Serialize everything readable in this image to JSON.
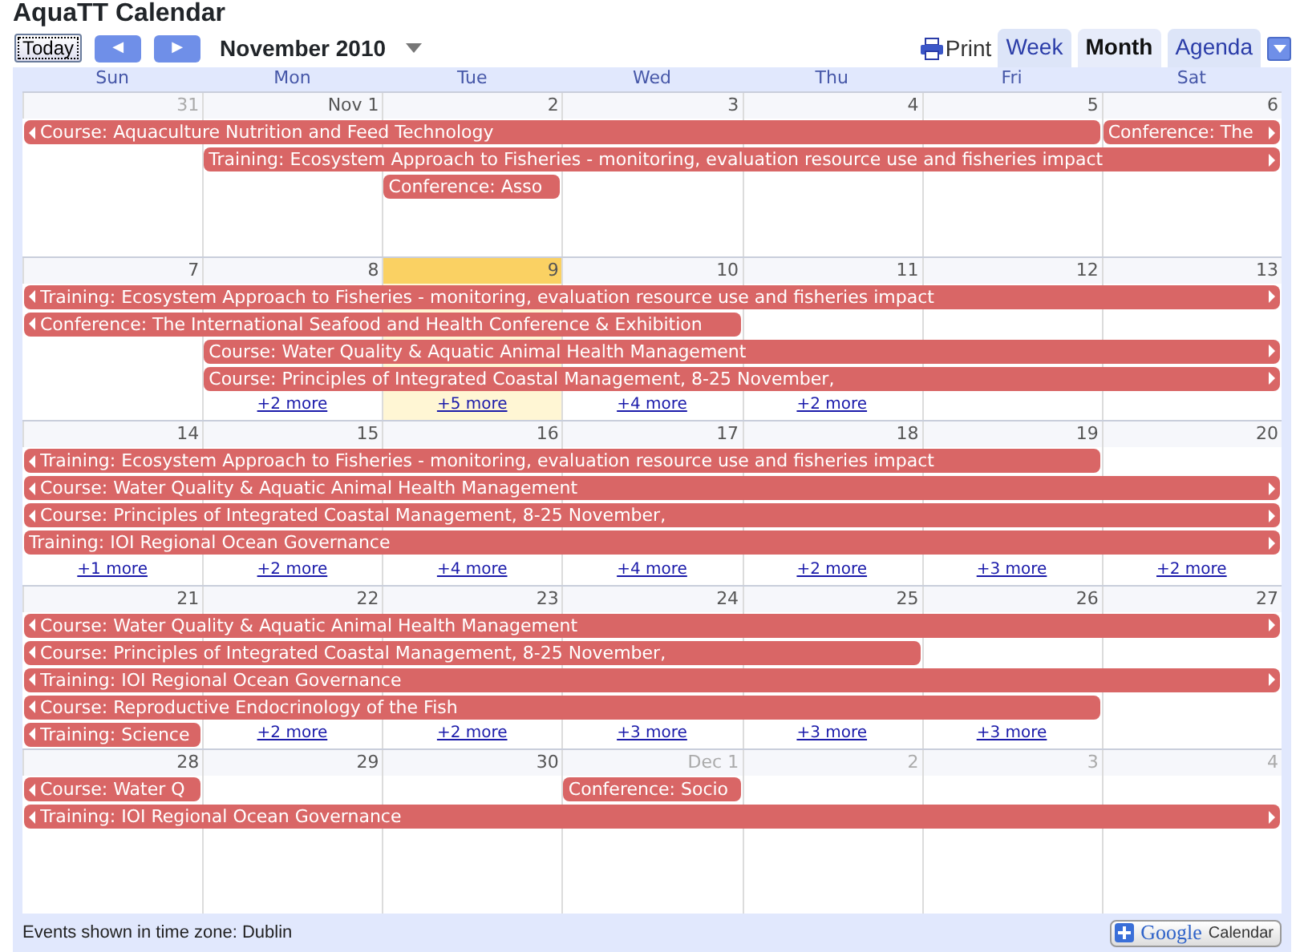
{
  "title": "AquaTT Calendar",
  "toolbar": {
    "today": "Today",
    "prev": "◀",
    "next": "▶",
    "period": "November 2010",
    "print": "Print"
  },
  "tabs": [
    {
      "label": "Week",
      "selected": false
    },
    {
      "label": "Month",
      "selected": true
    },
    {
      "label": "Agenda",
      "selected": false
    }
  ],
  "weekdays": [
    "Sun",
    "Mon",
    "Tue",
    "Wed",
    "Thu",
    "Fri",
    "Sat"
  ],
  "weeks": [
    {
      "days": [
        {
          "label": "31",
          "other_month": true,
          "today": false
        },
        {
          "label": "Nov 1",
          "other_month": false,
          "today": false
        },
        {
          "label": "2",
          "other_month": false,
          "today": false
        },
        {
          "label": "3",
          "other_month": false,
          "today": false
        },
        {
          "label": "4",
          "other_month": false,
          "today": false
        },
        {
          "label": "5",
          "other_month": false,
          "today": false
        },
        {
          "label": "6",
          "other_month": false,
          "today": false
        }
      ],
      "lanes": [
        [
          {
            "kind": "event",
            "title": "Course: Aquaculture Nutrition and Feed Technology",
            "continues_before": true,
            "continues_after": false
          },
          {
            "kind": "continued"
          },
          {
            "kind": "continued"
          },
          {
            "kind": "continued"
          },
          {
            "kind": "continued"
          },
          {
            "kind": "continued"
          },
          {
            "kind": "event",
            "title": "Conference: The",
            "continues_before": false,
            "continues_after": true
          }
        ],
        [
          {
            "kind": "empty"
          },
          {
            "kind": "event",
            "title": "Training: Ecosystem Approach to Fisheries - monitoring, evaluation resource use and fisheries impact",
            "continues_before": false,
            "continues_after": true
          },
          {
            "kind": "continued"
          },
          {
            "kind": "continued"
          },
          {
            "kind": "continued"
          },
          {
            "kind": "continued"
          },
          {
            "kind": "continued"
          }
        ],
        [
          {
            "kind": "empty"
          },
          {
            "kind": "empty"
          },
          {
            "kind": "event",
            "title": "Conference: Asso",
            "continues_before": false,
            "continues_after": false
          },
          {
            "kind": "empty"
          },
          {
            "kind": "empty"
          },
          {
            "kind": "empty"
          },
          {
            "kind": "empty"
          }
        ]
      ]
    },
    {
      "days": [
        {
          "label": "7",
          "other_month": false,
          "today": false
        },
        {
          "label": "8",
          "other_month": false,
          "today": false
        },
        {
          "label": "9",
          "other_month": false,
          "today": true
        },
        {
          "label": "10",
          "other_month": false,
          "today": false
        },
        {
          "label": "11",
          "other_month": false,
          "today": false
        },
        {
          "label": "12",
          "other_month": false,
          "today": false
        },
        {
          "label": "13",
          "other_month": false,
          "today": false
        }
      ],
      "lanes": [
        [
          {
            "kind": "event",
            "title": "Training: Ecosystem Approach to Fisheries - monitoring, evaluation resource use and fisheries impact",
            "continues_before": true,
            "continues_after": true
          },
          {
            "kind": "continued"
          },
          {
            "kind": "continued"
          },
          {
            "kind": "continued"
          },
          {
            "kind": "continued"
          },
          {
            "kind": "continued"
          },
          {
            "kind": "continued"
          }
        ],
        [
          {
            "kind": "event",
            "title": "Conference: The International Seafood and Health Conference & Exhibition",
            "continues_before": true,
            "continues_after": false
          },
          {
            "kind": "continued"
          },
          {
            "kind": "continued"
          },
          {
            "kind": "continued"
          },
          {
            "kind": "empty"
          },
          {
            "kind": "empty"
          },
          {
            "kind": "empty"
          }
        ],
        [
          {
            "kind": "empty"
          },
          {
            "kind": "event",
            "title": "Course: Water Quality & Aquatic Animal Health Management",
            "continues_before": false,
            "continues_after": true
          },
          {
            "kind": "continued"
          },
          {
            "kind": "continued"
          },
          {
            "kind": "continued"
          },
          {
            "kind": "continued"
          },
          {
            "kind": "continued"
          }
        ],
        [
          {
            "kind": "empty"
          },
          {
            "kind": "event",
            "title": "Course: Principles of Integrated Coastal Management, 8-25 November,",
            "continues_before": false,
            "continues_after": true
          },
          {
            "kind": "continued"
          },
          {
            "kind": "continued"
          },
          {
            "kind": "continued"
          },
          {
            "kind": "continued"
          },
          {
            "kind": "continued"
          }
        ],
        [
          {
            "kind": "empty"
          },
          {
            "kind": "more",
            "label": "+2 more"
          },
          {
            "kind": "more",
            "label": "+5 more"
          },
          {
            "kind": "more",
            "label": "+4 more"
          },
          {
            "kind": "more",
            "label": "+2 more"
          },
          {
            "kind": "empty"
          },
          {
            "kind": "empty"
          }
        ]
      ]
    },
    {
      "days": [
        {
          "label": "14",
          "other_month": false,
          "today": false
        },
        {
          "label": "15",
          "other_month": false,
          "today": false
        },
        {
          "label": "16",
          "other_month": false,
          "today": false
        },
        {
          "label": "17",
          "other_month": false,
          "today": false
        },
        {
          "label": "18",
          "other_month": false,
          "today": false
        },
        {
          "label": "19",
          "other_month": false,
          "today": false
        },
        {
          "label": "20",
          "other_month": false,
          "today": false
        }
      ],
      "lanes": [
        [
          {
            "kind": "event",
            "title": "Training: Ecosystem Approach to Fisheries - monitoring, evaluation resource use and fisheries impact",
            "continues_before": true,
            "continues_after": false
          },
          {
            "kind": "continued"
          },
          {
            "kind": "continued"
          },
          {
            "kind": "continued"
          },
          {
            "kind": "continued"
          },
          {
            "kind": "continued"
          },
          {
            "kind": "empty"
          }
        ],
        [
          {
            "kind": "event",
            "title": "Course: Water Quality & Aquatic Animal Health Management",
            "continues_before": true,
            "continues_after": true
          },
          {
            "kind": "continued"
          },
          {
            "kind": "continued"
          },
          {
            "kind": "continued"
          },
          {
            "kind": "continued"
          },
          {
            "kind": "continued"
          },
          {
            "kind": "continued"
          }
        ],
        [
          {
            "kind": "event",
            "title": "Course: Principles of Integrated Coastal Management, 8-25 November,",
            "continues_before": true,
            "continues_after": true
          },
          {
            "kind": "continued"
          },
          {
            "kind": "continued"
          },
          {
            "kind": "continued"
          },
          {
            "kind": "continued"
          },
          {
            "kind": "continued"
          },
          {
            "kind": "continued"
          }
        ],
        [
          {
            "kind": "event",
            "title": "Training: IOI Regional Ocean Governance",
            "continues_before": false,
            "continues_after": true
          },
          {
            "kind": "continued"
          },
          {
            "kind": "continued"
          },
          {
            "kind": "continued"
          },
          {
            "kind": "continued"
          },
          {
            "kind": "continued"
          },
          {
            "kind": "continued"
          }
        ],
        [
          {
            "kind": "more",
            "label": "+1 more"
          },
          {
            "kind": "more",
            "label": "+2 more"
          },
          {
            "kind": "more",
            "label": "+4 more"
          },
          {
            "kind": "more",
            "label": "+4 more"
          },
          {
            "kind": "more",
            "label": "+2 more"
          },
          {
            "kind": "more",
            "label": "+3 more"
          },
          {
            "kind": "more",
            "label": "+2 more"
          }
        ]
      ]
    },
    {
      "days": [
        {
          "label": "21",
          "other_month": false,
          "today": false
        },
        {
          "label": "22",
          "other_month": false,
          "today": false
        },
        {
          "label": "23",
          "other_month": false,
          "today": false
        },
        {
          "label": "24",
          "other_month": false,
          "today": false
        },
        {
          "label": "25",
          "other_month": false,
          "today": false
        },
        {
          "label": "26",
          "other_month": false,
          "today": false
        },
        {
          "label": "27",
          "other_month": false,
          "today": false
        }
      ],
      "lanes": [
        [
          {
            "kind": "event",
            "title": "Course: Water Quality & Aquatic Animal Health Management",
            "continues_before": true,
            "continues_after": true
          },
          {
            "kind": "continued"
          },
          {
            "kind": "continued"
          },
          {
            "kind": "continued"
          },
          {
            "kind": "continued"
          },
          {
            "kind": "continued"
          },
          {
            "kind": "continued"
          }
        ],
        [
          {
            "kind": "event",
            "title": "Course: Principles of Integrated Coastal Management, 8-25 November,",
            "continues_before": true,
            "continues_after": false
          },
          {
            "kind": "continued"
          },
          {
            "kind": "continued"
          },
          {
            "kind": "continued"
          },
          {
            "kind": "continued"
          },
          {
            "kind": "empty"
          },
          {
            "kind": "empty"
          }
        ],
        [
          {
            "kind": "event",
            "title": "Training: IOI Regional Ocean Governance",
            "continues_before": true,
            "continues_after": true
          },
          {
            "kind": "continued"
          },
          {
            "kind": "continued"
          },
          {
            "kind": "continued"
          },
          {
            "kind": "continued"
          },
          {
            "kind": "continued"
          },
          {
            "kind": "continued"
          }
        ],
        [
          {
            "kind": "event",
            "title": "Course: Reproductive Endocrinology of the Fish",
            "continues_before": true,
            "continues_after": false
          },
          {
            "kind": "continued"
          },
          {
            "kind": "continued"
          },
          {
            "kind": "continued"
          },
          {
            "kind": "continued"
          },
          {
            "kind": "continued"
          },
          {
            "kind": "empty"
          }
        ],
        [
          {
            "kind": "event",
            "title": "Training: Science",
            "continues_before": true,
            "continues_after": false
          },
          {
            "kind": "more",
            "label": "+2 more"
          },
          {
            "kind": "more",
            "label": "+2 more"
          },
          {
            "kind": "more",
            "label": "+3 more"
          },
          {
            "kind": "more",
            "label": "+3 more"
          },
          {
            "kind": "more",
            "label": "+3 more"
          },
          {
            "kind": "empty"
          }
        ]
      ]
    },
    {
      "days": [
        {
          "label": "28",
          "other_month": false,
          "today": false
        },
        {
          "label": "29",
          "other_month": false,
          "today": false
        },
        {
          "label": "30",
          "other_month": false,
          "today": false
        },
        {
          "label": "Dec 1",
          "other_month": true,
          "today": false
        },
        {
          "label": "2",
          "other_month": true,
          "today": false
        },
        {
          "label": "3",
          "other_month": true,
          "today": false
        },
        {
          "label": "4",
          "other_month": true,
          "today": false
        }
      ],
      "lanes": [
        [
          {
            "kind": "event",
            "title": "Course: Water Q",
            "continues_before": true,
            "continues_after": false
          },
          {
            "kind": "empty"
          },
          {
            "kind": "empty"
          },
          {
            "kind": "event",
            "title": "Conference: Socio",
            "continues_before": false,
            "continues_after": false
          },
          {
            "kind": "empty"
          },
          {
            "kind": "empty"
          },
          {
            "kind": "empty"
          }
        ],
        [
          {
            "kind": "event",
            "title": "Training: IOI Regional Ocean Governance",
            "continues_before": true,
            "continues_after": true
          },
          {
            "kind": "continued"
          },
          {
            "kind": "continued"
          },
          {
            "kind": "continued"
          },
          {
            "kind": "continued"
          },
          {
            "kind": "continued"
          },
          {
            "kind": "continued"
          }
        ]
      ]
    }
  ],
  "footer": {
    "timezone": "Events shown in time zone: Dublin",
    "badge_brand": "Google",
    "badge_label": "Calendar"
  }
}
